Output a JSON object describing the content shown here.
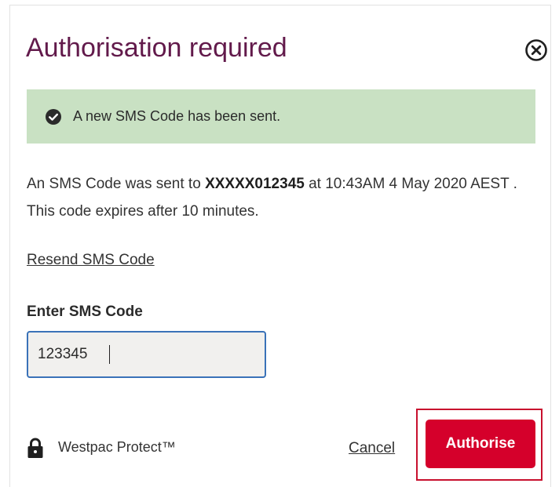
{
  "dialog": {
    "title": "Authorisation required",
    "close_icon": "close-circle-icon"
  },
  "banner": {
    "icon": "check-circle-icon",
    "message": "A new SMS Code has been sent."
  },
  "info": {
    "prefix": "An SMS Code was sent to ",
    "phone": "XXXXX012345",
    "middle": " at 10:43AM 4 May 2020 AEST . This code expires after 10 minutes."
  },
  "resend_link": "Resend SMS Code",
  "code_field": {
    "label": "Enter SMS Code",
    "value": "123345"
  },
  "footer": {
    "lock_icon": "lock-icon",
    "brand": "Westpac Protect™",
    "cancel_label": "Cancel",
    "authorise_label": "Authorise"
  },
  "colors": {
    "title": "#621a4b",
    "banner_bg": "#c9e1c3",
    "primary_button": "#d5002b",
    "input_border": "#3a72b8",
    "highlight_frame": "#c8102e"
  }
}
